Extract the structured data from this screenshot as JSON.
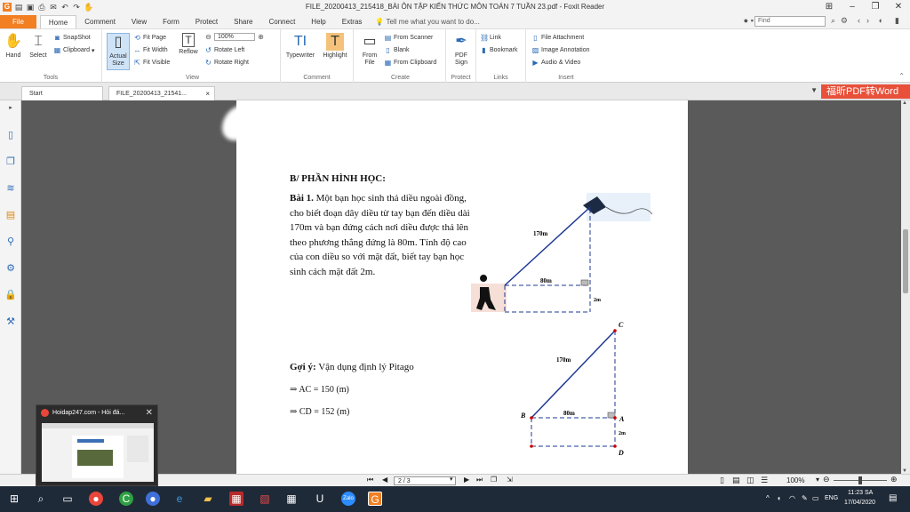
{
  "window": {
    "title": "FILE_20200413_215418_BÀI ÔN TẬP KIẾN THỨC MÔN TOÁN 7 TUẦN 23.pdf - Foxit Reader"
  },
  "menu": {
    "file": "File",
    "tabs": [
      "Home",
      "Comment",
      "View",
      "Form",
      "Protect",
      "Share",
      "Connect",
      "Help",
      "Extras"
    ],
    "tell_me": "Tell me what you want to do...",
    "find_placeholder": "Find"
  },
  "ribbon": {
    "tools": {
      "label": "Tools",
      "hand": "Hand",
      "select": "Select",
      "snapshot": "SnapShot",
      "clipboard": "Clipboard"
    },
    "view": {
      "label": "View",
      "actual_size": "Actual Size",
      "fit_page": "Fit Page",
      "fit_width": "Fit Width",
      "fit_visible": "Fit Visible",
      "reflow": "Reflow",
      "zoom": "100%",
      "rotate_left": "Rotate Left",
      "rotate_right": "Rotate Right"
    },
    "comment": {
      "label": "Comment",
      "typewriter": "Typewriter",
      "highlight": "Highlight"
    },
    "create": {
      "label": "Create",
      "from_file": "From File",
      "from_scanner": "From Scanner",
      "blank": "Blank",
      "from_clipboard": "From Clipboard"
    },
    "protect": {
      "label": "Protect",
      "pdf_sign": "PDF Sign"
    },
    "links": {
      "label": "Links",
      "link": "Link",
      "bookmark": "Bookmark"
    },
    "insert": {
      "label": "Insert",
      "file_attachment": "File Attachment",
      "image_annotation": "Image Annotation",
      "audio_video": "Audio & Video"
    }
  },
  "doctabs": {
    "start": "Start",
    "file": "FILE_20200413_21541..."
  },
  "convert_banner": "福昕PDF转Word",
  "document": {
    "section": "B/ PHẦN HÌNH HỌC:",
    "bai_label": "Bài 1.",
    "problem": "Một bạn học sinh thả diều ngoài đồng, cho biết đoạn dây diều từ tay bạn đến diều dài 170m và bạn đứng cách nơi diều được thả lên theo phương thẳng đứng là 80m. Tính độ cao của con diều so với mặt đất, biết tay bạn học sinh cách mặt đất 2m.",
    "hint_label": "Gợi ý:",
    "hint": "Vận dụng định lý Pitago",
    "step1": "⇒ AC = 150 (m)",
    "step2": "⇒ CD = 152 (m)",
    "fig1": {
      "rope": "170m",
      "ground": "80m",
      "hand_height": "2m"
    },
    "fig2": {
      "rope": "170m",
      "ground": "80m",
      "hand_height": "2m",
      "C": "C",
      "B": "B",
      "A": "A",
      "D": "D"
    }
  },
  "status": {
    "page": "2 / 3",
    "zoom": "100%"
  },
  "taskbar": {
    "time": "11:23 SA",
    "date": "17/04/2020",
    "lang": "ENG"
  },
  "thumbnail": {
    "title": "Hoidap247.com - Hỏi đá..."
  },
  "colors": {
    "accent": "#f27f22",
    "convert": "#e8503a",
    "line": "#1f3a93"
  }
}
